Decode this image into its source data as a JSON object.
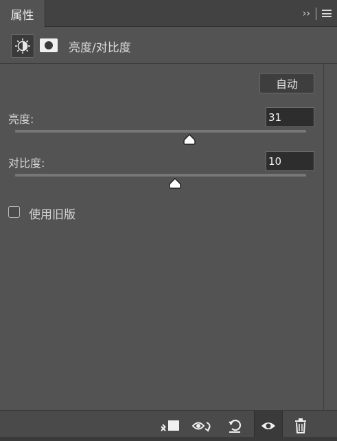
{
  "tab": {
    "label": "属性"
  },
  "tab_controls": {
    "collapse_glyph": "›› "
  },
  "panel": {
    "title": "亮度/对比度"
  },
  "auto_button": {
    "label": "自动"
  },
  "brightness": {
    "label": "亮度:",
    "value": "31",
    "slider_fraction": 0.6
  },
  "contrast": {
    "label": "对比度:",
    "value": "10",
    "slider_fraction": 0.55
  },
  "legacy": {
    "label": "使用旧版",
    "checked": false
  },
  "icons": {
    "adjustment": "brightness-contrast-icon",
    "mask": "layer-mask-icon",
    "clip": "clip-to-layer-icon",
    "view_previous": "view-previous-state-icon",
    "reset": "reset-adjustment-icon",
    "visibility": "eye-icon",
    "delete": "trash-icon"
  },
  "colors": {
    "panel_bg": "#535353",
    "tab_bar_bg": "#424242",
    "input_bg": "#2d2d2d"
  }
}
